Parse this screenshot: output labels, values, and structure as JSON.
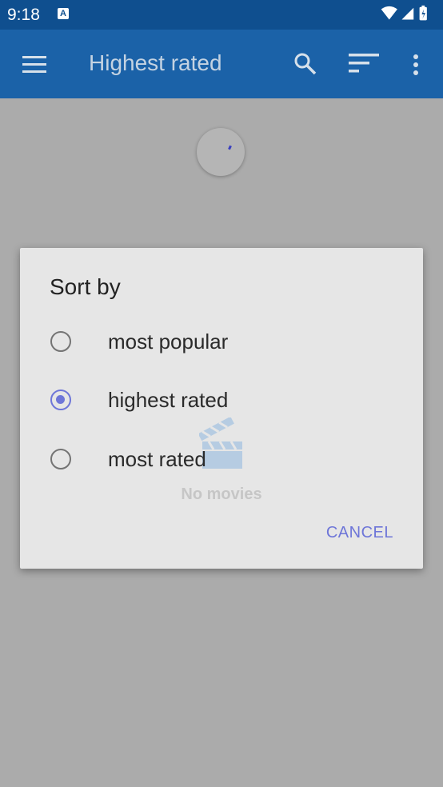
{
  "status_bar": {
    "time": "9:18",
    "notification_icon": "a-icon"
  },
  "app_bar": {
    "title": "Highest rated",
    "icons": [
      "menu-icon",
      "search-icon",
      "sort-icon",
      "more-vert-icon"
    ]
  },
  "content": {
    "empty_text": "No movies"
  },
  "dialog": {
    "title": "Sort by",
    "options": [
      {
        "label": "most popular",
        "checked": false
      },
      {
        "label": "highest rated",
        "checked": true
      },
      {
        "label": "most rated",
        "checked": false
      }
    ],
    "cancel_label": "CANCEL"
  },
  "colors": {
    "status_bar": "#0f4f8f",
    "app_bar": "#1b62a8",
    "accent": "#6e76d8",
    "scrim_background": "#ababab",
    "dialog_background": "#e6e6e6"
  }
}
